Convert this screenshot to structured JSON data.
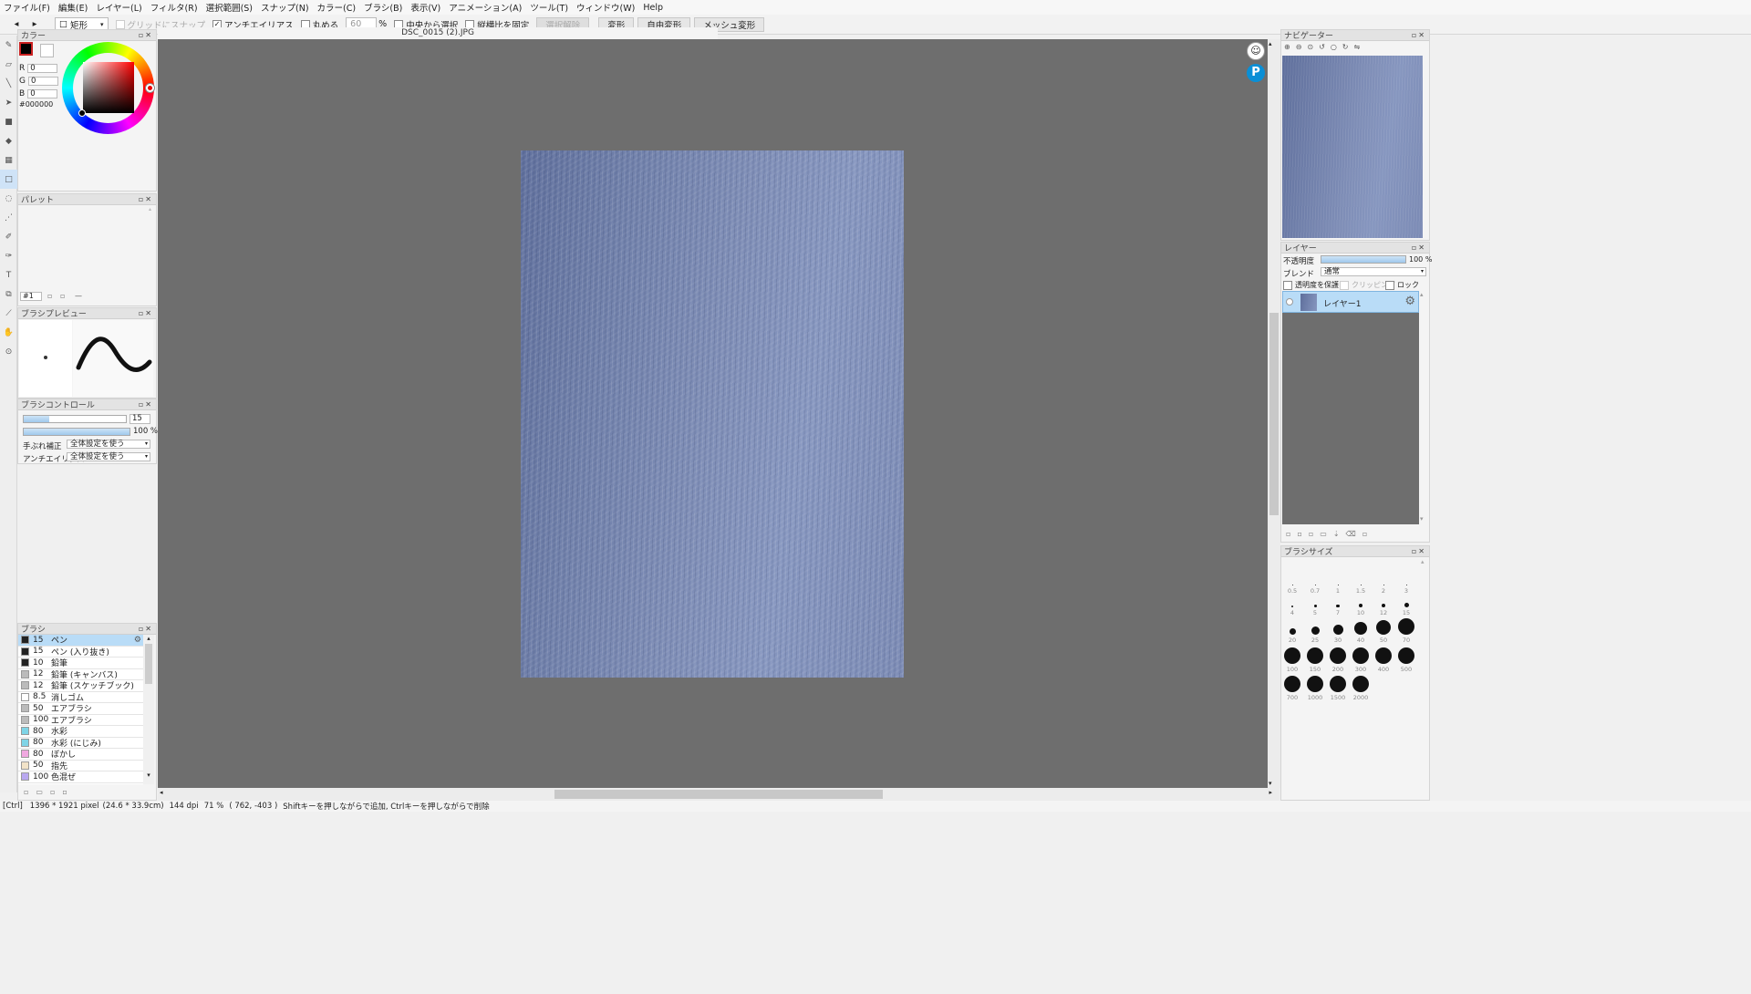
{
  "menu": [
    "ファイル(F)",
    "編集(E)",
    "レイヤー(L)",
    "フィルタ(R)",
    "選択範囲(S)",
    "スナップ(N)",
    "カラー(C)",
    "ブラシ(B)",
    "表示(V)",
    "アニメーション(A)",
    "ツール(T)",
    "ウィンドウ(W)",
    "Help"
  ],
  "toolbar": {
    "shape": "矩形",
    "grid_snap": "グリッドにスナップ",
    "antialias": "アンチエイリアス",
    "round": "丸める",
    "round_value": "60",
    "round_unit": "%",
    "from_center": "中央から選択",
    "fix_ratio": "縦横比を固定",
    "clear_selection": "選択解除",
    "transform": "変形",
    "free_transform": "自由変形",
    "mesh_transform": "メッシュ変形"
  },
  "color_panel": {
    "title": "カラー",
    "r_label": "R",
    "r": "0",
    "g_label": "G",
    "g": "0",
    "b_label": "B",
    "b": "0",
    "hex": "#000000",
    "fg": "#000000",
    "bg": "#ffffff"
  },
  "palette_panel": {
    "title": "パレット",
    "page": "#1"
  },
  "brush_preview": {
    "title": "ブラシプレビュー"
  },
  "brush_control": {
    "title": "ブラシコントロール",
    "size": "15",
    "size_fill": 0.25,
    "opacity": "100 %",
    "stabilizer_label": "手ぶれ補正",
    "stabilizer_value": "全体設定を使う",
    "antialias_label": "アンチエイリアス",
    "antialias_value": "全体設定を使う"
  },
  "brush_panel": {
    "title": "ブラシ",
    "items": [
      {
        "size": "15",
        "name": "ペン",
        "color": "#222222"
      },
      {
        "size": "15",
        "name": "ペン (入り抜き)",
        "color": "#222222"
      },
      {
        "size": "10",
        "name": "鉛筆",
        "color": "#222222"
      },
      {
        "size": "12",
        "name": "鉛筆 (キャンバス)",
        "color": "#bbbbbb"
      },
      {
        "size": "12",
        "name": "鉛筆 (スケッチブック)",
        "color": "#bbbbbb"
      },
      {
        "size": "8.5",
        "name": "消しゴム",
        "color": "#ffffff"
      },
      {
        "size": "50",
        "name": "エアブラシ",
        "color": "#bbbbbb"
      },
      {
        "size": "100",
        "name": "エアブラシ",
        "color": "#bbbbbb"
      },
      {
        "size": "80",
        "name": "水彩",
        "color": "#7fd4e6"
      },
      {
        "size": "80",
        "name": "水彩 (にじみ)",
        "color": "#7fd4e6"
      },
      {
        "size": "80",
        "name": "ぼかし",
        "color": "#f0a8e0"
      },
      {
        "size": "50",
        "name": "指先",
        "color": "#f2e3c8"
      },
      {
        "size": "100",
        "name": "色混ぜ",
        "color": "#b9a8f0"
      }
    ]
  },
  "document": {
    "tab": "DSC_0015 (2).JPG"
  },
  "navigator": {
    "title": "ナビゲーター"
  },
  "layer_panel": {
    "title": "レイヤー",
    "opacity_label": "不透明度",
    "opacity_value": "100 %",
    "blend_label": "ブレンド",
    "blend_value": "通常",
    "protect_alpha": "透明度を保護",
    "clipping": "クリッピング",
    "lock": "ロック",
    "layers": [
      {
        "name": "レイヤー1"
      }
    ]
  },
  "brush_size_panel": {
    "title": "ブラシサイズ",
    "sizes": [
      "0.5",
      "0.7",
      "1",
      "1.5",
      "2",
      "3",
      "4",
      "5",
      "7",
      "10",
      "12",
      "15",
      "20",
      "25",
      "30",
      "40",
      "50",
      "70",
      "100",
      "150",
      "200",
      "300",
      "400",
      "500",
      "700",
      "1000",
      "1500",
      "2000"
    ]
  },
  "status": {
    "mod": "[Ctrl]",
    "image_size": "1396 * 1921 pixel",
    "physical": "(24.6 * 33.9cm)",
    "dpi": "144 dpi",
    "zoom": "71 %",
    "coords": "( 762, -403 )",
    "hint": "Shiftキーを押しながらで追加, Ctrlキーを押しながらで削除"
  }
}
